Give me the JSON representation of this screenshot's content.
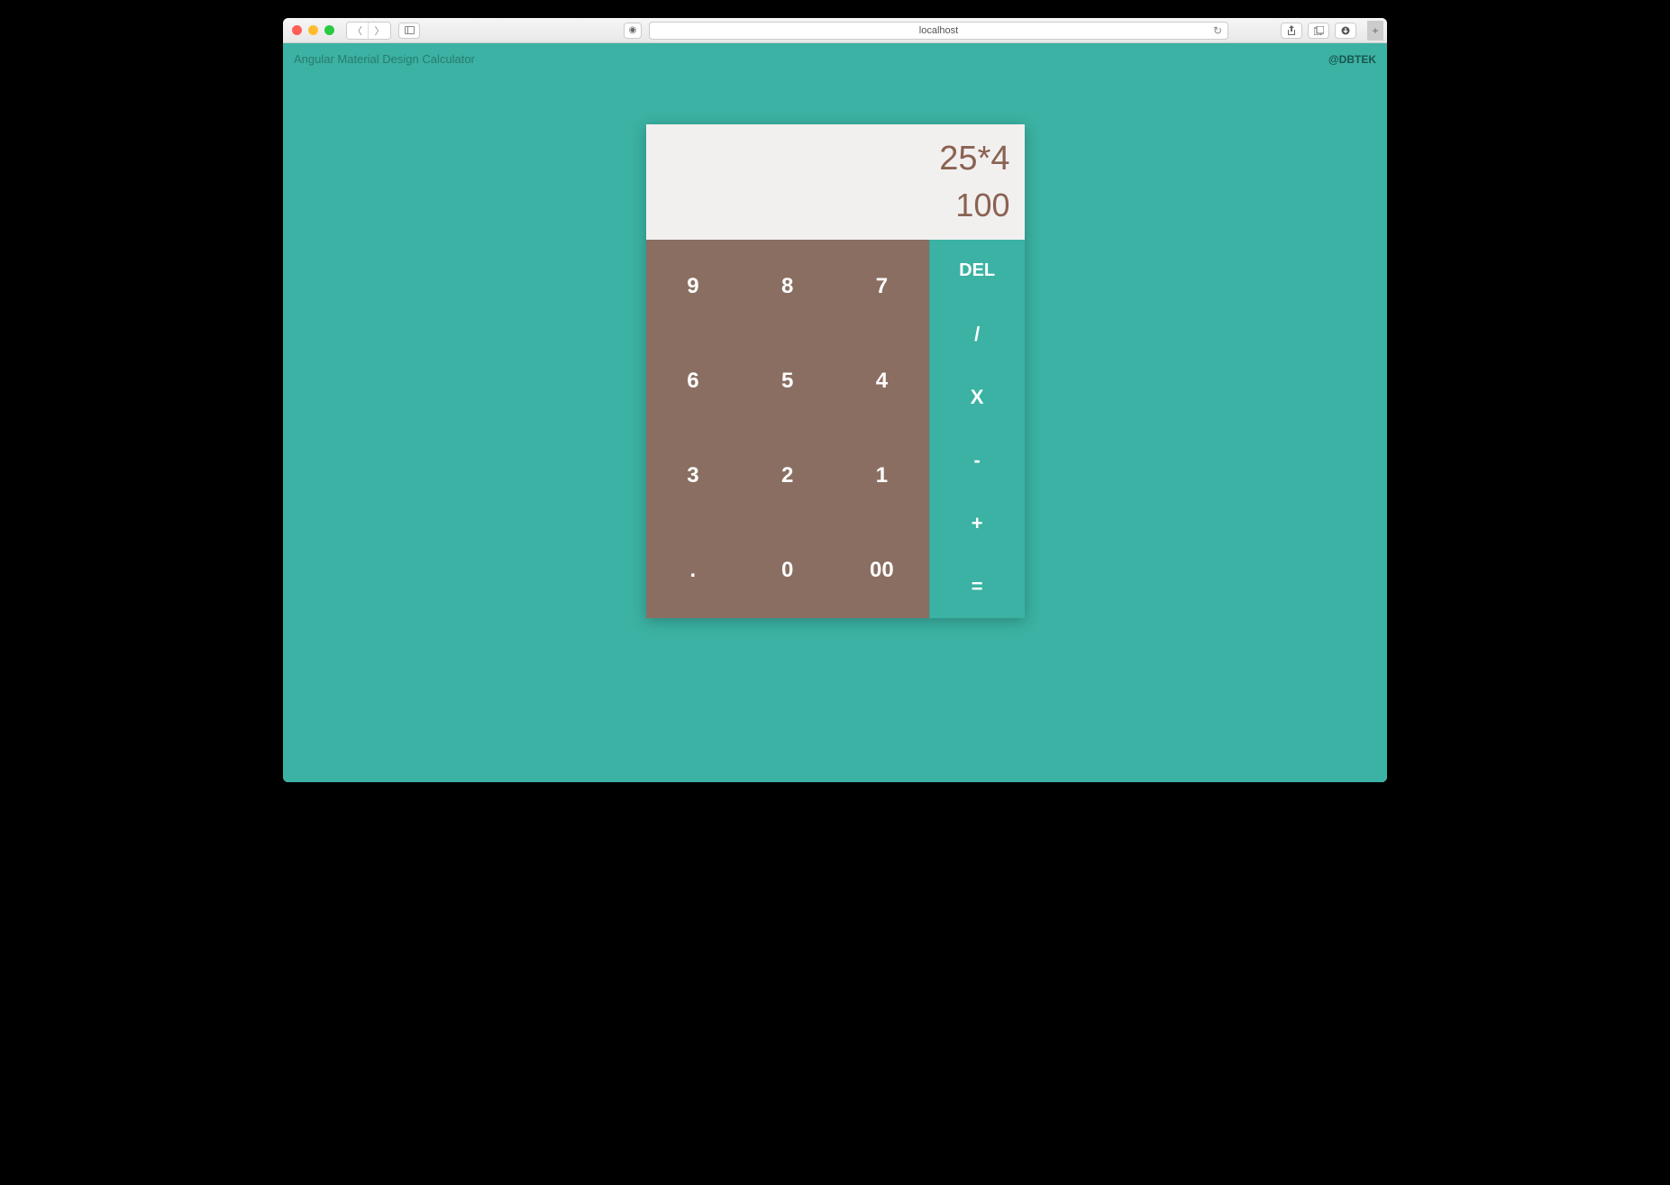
{
  "browser": {
    "url": "localhost"
  },
  "header": {
    "title": "Angular Material Design Calculator",
    "author": "@DBTEK"
  },
  "calculator": {
    "expression": "25*4",
    "result": "100"
  },
  "digits": {
    "r0c0": "9",
    "r0c1": "8",
    "r0c2": "7",
    "r1c0": "6",
    "r1c1": "5",
    "r1c2": "4",
    "r2c0": "3",
    "r2c1": "2",
    "r2c2": "1",
    "r3c0": ".",
    "r3c1": "0",
    "r3c2": "00"
  },
  "ops": {
    "del": "DEL",
    "div": "/",
    "mul": "X",
    "sub": "-",
    "add": "+",
    "eq": "="
  }
}
